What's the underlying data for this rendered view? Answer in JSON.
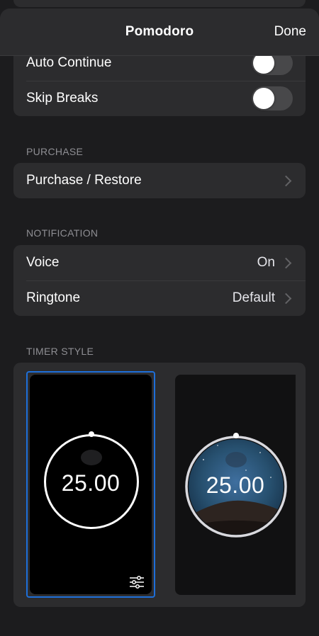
{
  "nav": {
    "title": "Pomodoro",
    "done_label": "Done"
  },
  "toggles": [
    {
      "label": "Auto Continue",
      "on": false
    },
    {
      "label": "Skip Breaks",
      "on": false
    }
  ],
  "purchase": {
    "header": "PURCHASE",
    "row_label": "Purchase / Restore"
  },
  "notification": {
    "header": "NOTIFICATION",
    "rows": [
      {
        "label": "Voice",
        "value": "On"
      },
      {
        "label": "Ringtone",
        "value": "Default"
      }
    ]
  },
  "timer_style": {
    "header": "TIMER STYLE",
    "styles": [
      {
        "time": "25.00",
        "selected": true
      },
      {
        "time": "25.00",
        "selected": false
      }
    ]
  },
  "colors": {
    "accent": "#1e6fd9",
    "background": "#1c1c1e",
    "card": "#2c2c2e"
  }
}
